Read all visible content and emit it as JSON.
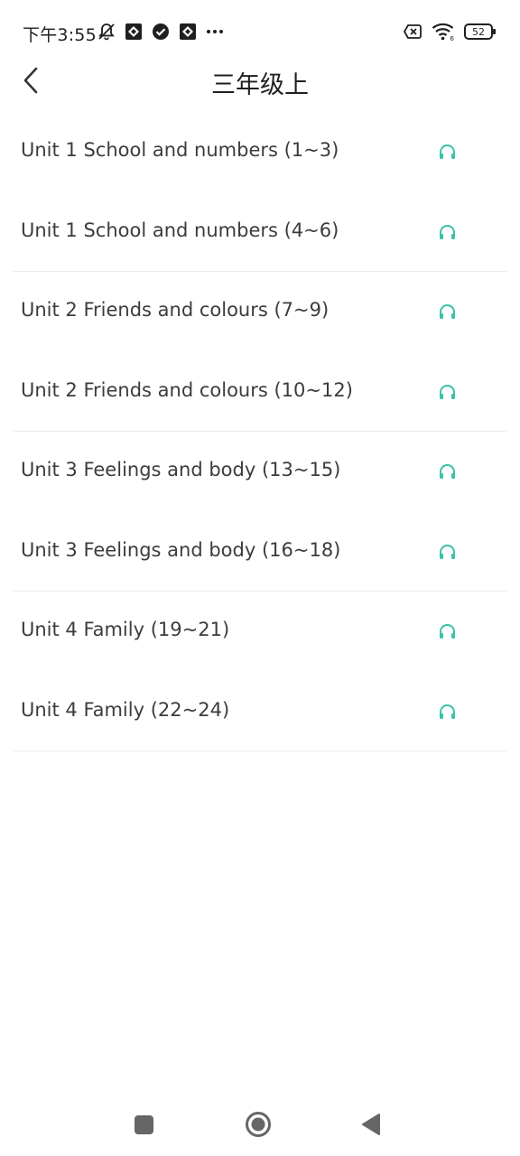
{
  "status_bar": {
    "time": "下午3:55",
    "battery_level": "52",
    "left_icons": [
      "muted-bell-icon",
      "app-notification-icon",
      "check-circle-icon",
      "app-notification-icon",
      "more-dots-icon"
    ],
    "right_icons": [
      "no-sim-icon",
      "wifi-icon",
      "battery-icon"
    ]
  },
  "header": {
    "title": "三年级上",
    "back_icon": "chevron-left-icon"
  },
  "colors": {
    "accent": "#3cc2a6",
    "text": "#3c3c3c",
    "divider": "#ececec"
  },
  "units": [
    {
      "label": "Unit 1 School and numbers (1~3)",
      "icon": "headphones-icon"
    },
    {
      "label": "Unit 1 School and numbers (4~6)",
      "icon": "headphones-icon"
    },
    {
      "label": "Unit 2 Friends and colours (7~9)",
      "icon": "headphones-icon"
    },
    {
      "label": "Unit 2 Friends and colours (10~12)",
      "icon": "headphones-icon"
    },
    {
      "label": "Unit 3 Feelings and body (13~15)",
      "icon": "headphones-icon"
    },
    {
      "label": "Unit 3 Feelings and body (16~18)",
      "icon": "headphones-icon"
    },
    {
      "label": "Unit 4 Family (19~21)",
      "icon": "headphones-icon"
    },
    {
      "label": "Unit 4 Family (22~24)",
      "icon": "headphones-icon"
    }
  ],
  "nav_bar": {
    "icons": [
      "recent-apps-icon",
      "home-icon",
      "back-triangle-icon"
    ]
  }
}
